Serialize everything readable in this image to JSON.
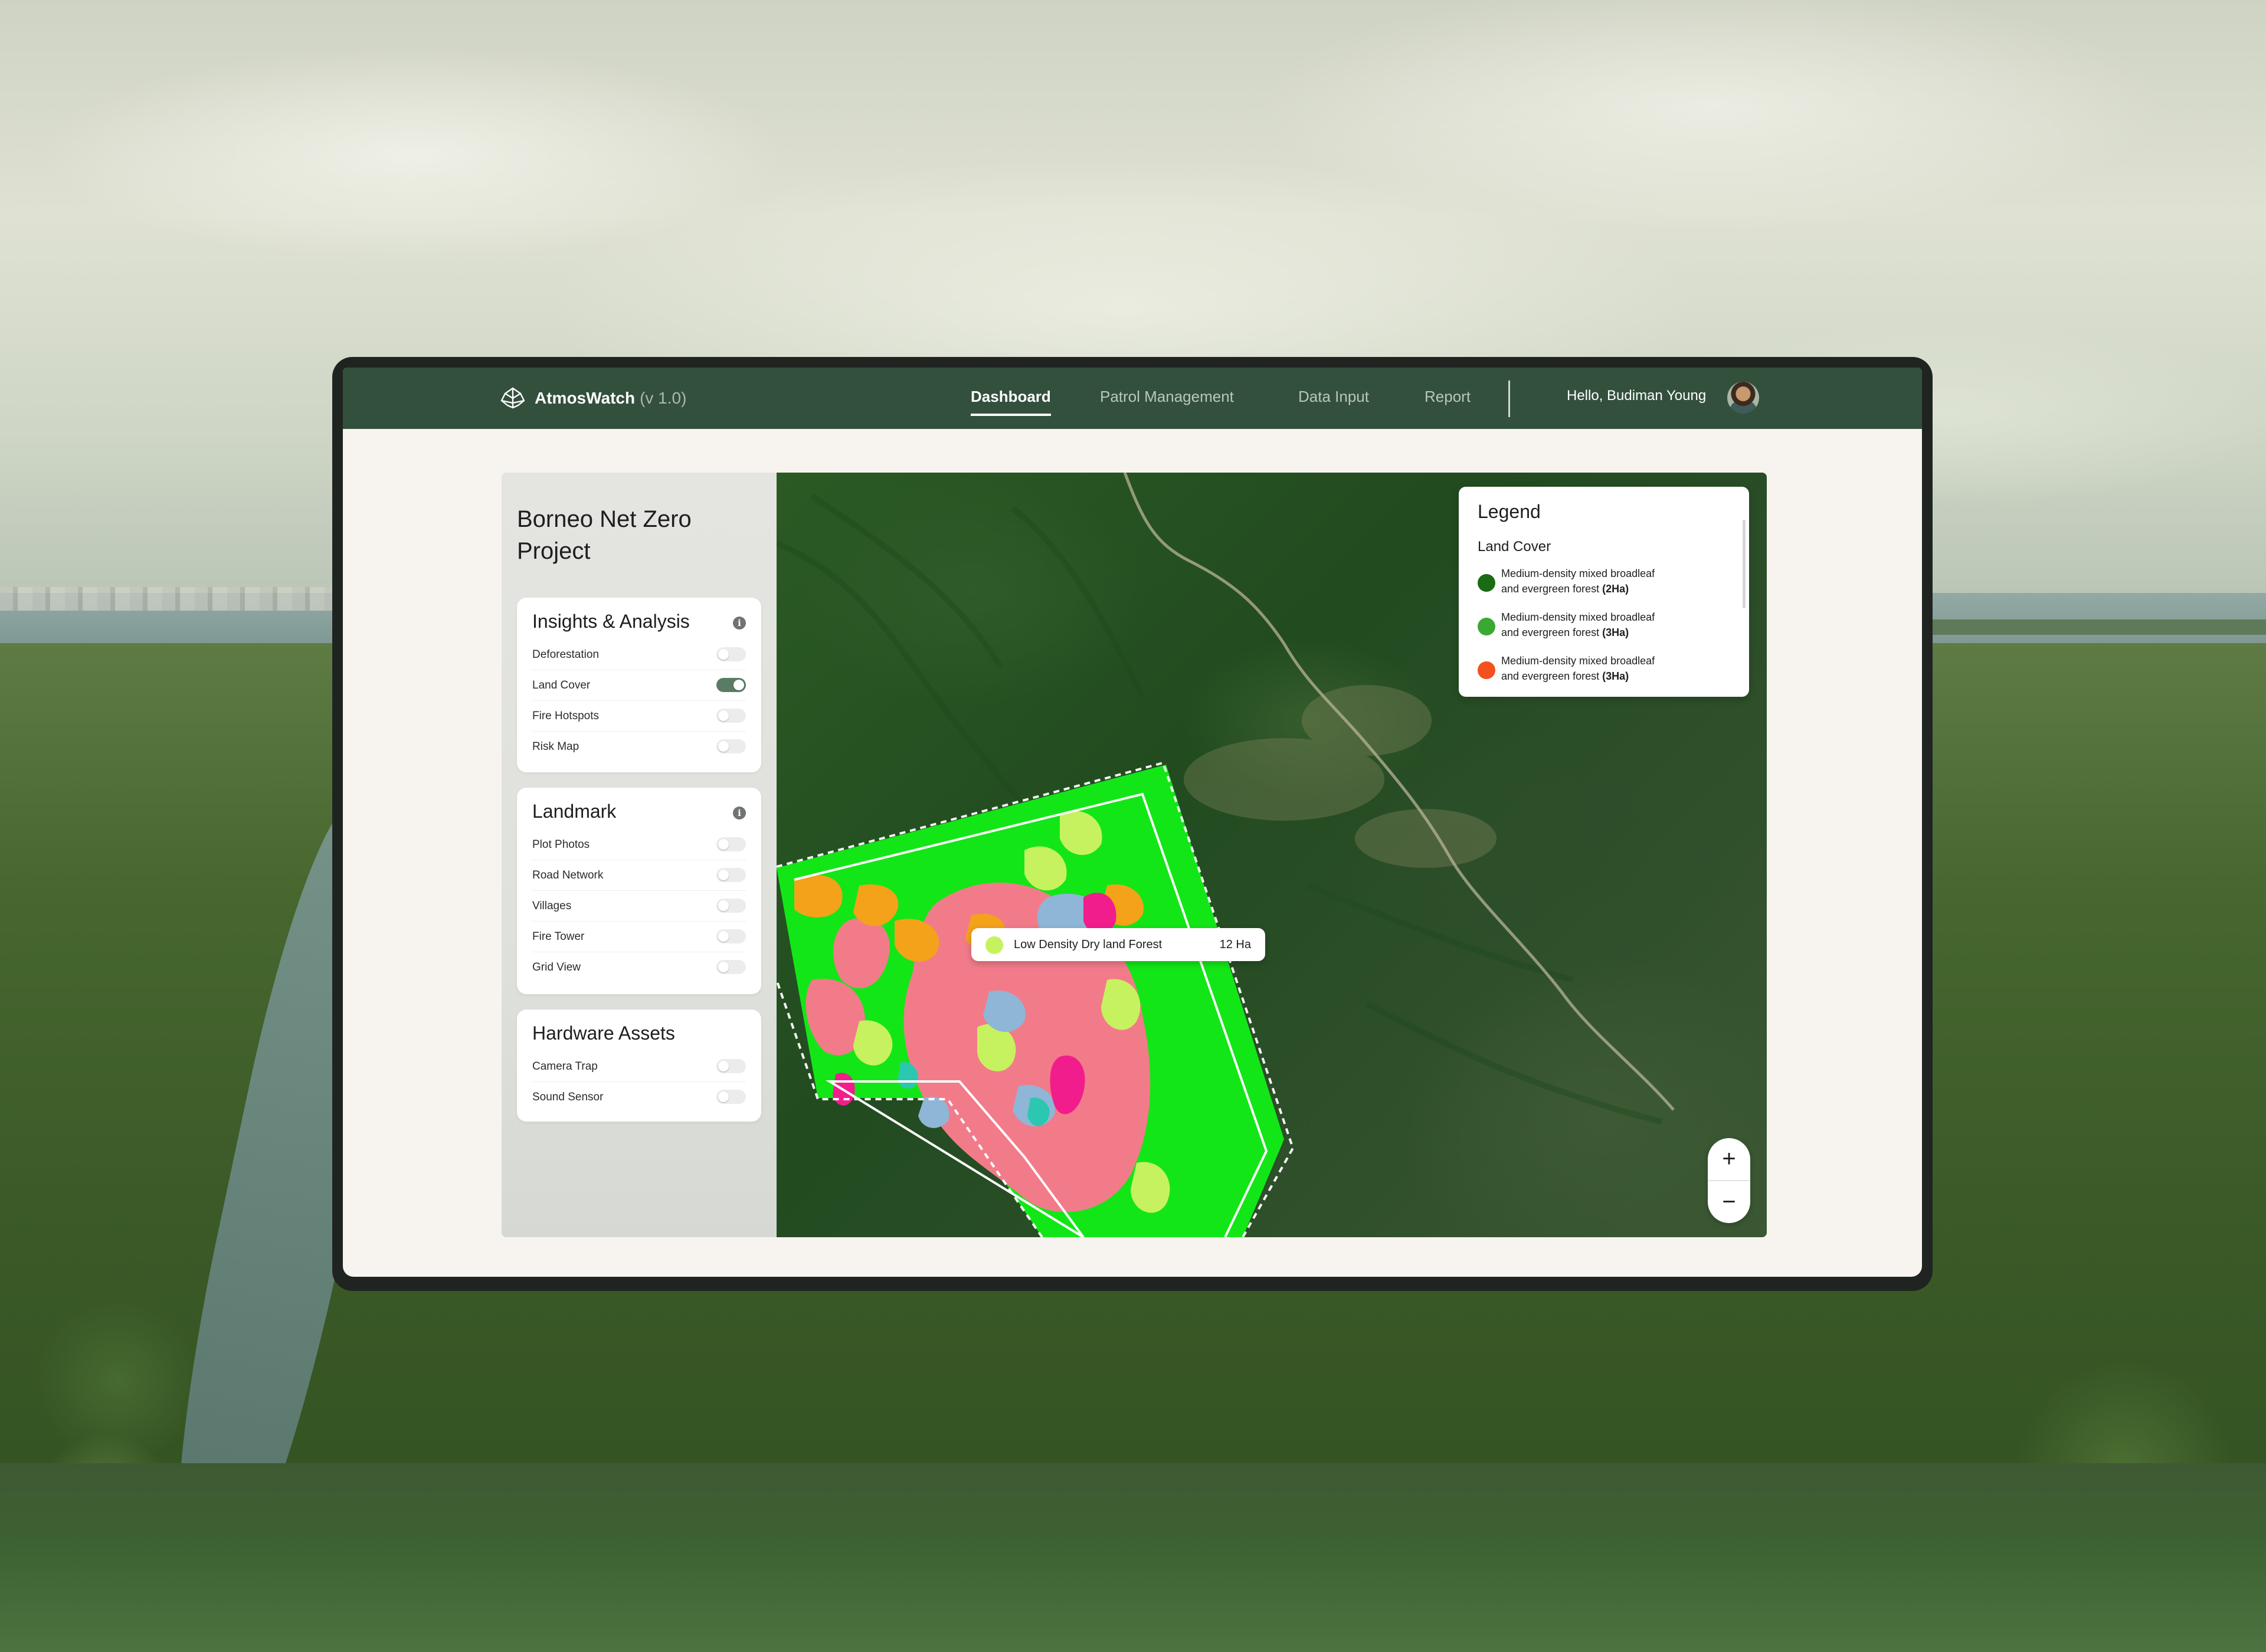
{
  "app": {
    "name": "AtmosWatch",
    "version": "(v 1.0)",
    "logo_icon": "tree-leaf-icon"
  },
  "nav": {
    "items": [
      {
        "label": "Dashboard",
        "active": true
      },
      {
        "label": "Patrol Management",
        "active": false
      },
      {
        "label": "Data Input",
        "active": false
      },
      {
        "label": "Report",
        "active": false
      }
    ],
    "greeting": "Hello, Budiman Young"
  },
  "project": {
    "title": "Borneo Net Zero Project"
  },
  "panels": {
    "insights": {
      "title": "Insights & Analysis",
      "items": [
        {
          "label": "Deforestation",
          "on": false
        },
        {
          "label": "Land Cover",
          "on": true
        },
        {
          "label": "Fire Hotspots",
          "on": false
        },
        {
          "label": "Risk Map",
          "on": false
        }
      ]
    },
    "landmark": {
      "title": "Landmark",
      "items": [
        {
          "label": "Plot Photos",
          "on": false
        },
        {
          "label": "Road Network",
          "on": false
        },
        {
          "label": "Villages",
          "on": false
        },
        {
          "label": "Fire Tower",
          "on": false
        },
        {
          "label": "Grid View",
          "on": false
        }
      ]
    },
    "hardware": {
      "title": "Hardware Assets",
      "items": [
        {
          "label": "Camera Trap",
          "on": false
        },
        {
          "label": "Sound Sensor",
          "on": false
        }
      ]
    }
  },
  "legend": {
    "title": "Legend",
    "subtitle": "Land Cover",
    "items": [
      {
        "line1": "Medium-density mixed broadleaf",
        "line2": "and evergreen forest",
        "area": "(2Ha)",
        "color": "#1a6b14"
      },
      {
        "line1": "Medium-density mixed broadleaf",
        "line2": "and evergreen forest",
        "area": "(3Ha)",
        "color": "#3aa832"
      },
      {
        "line1": "Medium-density mixed broadleaf",
        "line2": "and evergreen forest",
        "area": "(3Ha)",
        "color": "#f4511e"
      }
    ]
  },
  "tooltip": {
    "label": "Low Density Dry land Forest",
    "value": "12 Ha",
    "color": "#c7f25f"
  },
  "zoom": {
    "in": "+",
    "out": "−"
  },
  "colors": {
    "nav_bg": "#33503d",
    "toggle_on": "#5a7b64",
    "land_bright_green": "#13e617",
    "land_pink": "#f27b8a",
    "land_orange": "#f4a21a",
    "land_lime": "#c7f25f",
    "land_magenta": "#f21d8c",
    "land_blue": "#8fb6d6",
    "land_teal": "#2cc7b0"
  }
}
